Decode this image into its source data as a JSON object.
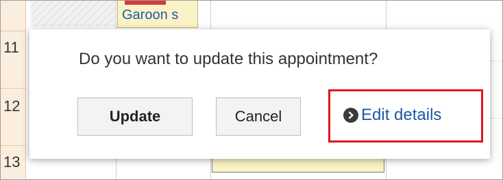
{
  "calendar": {
    "hours": [
      "11",
      "12",
      "13"
    ],
    "event_chip_title": "Garoon s"
  },
  "dialog": {
    "question": "Do you want to update this appointment?",
    "update_label": "Update",
    "cancel_label": "Cancel",
    "edit_details_label": "Edit details",
    "highlight_color": "#e3141b",
    "link_color": "#1f5aa6"
  }
}
